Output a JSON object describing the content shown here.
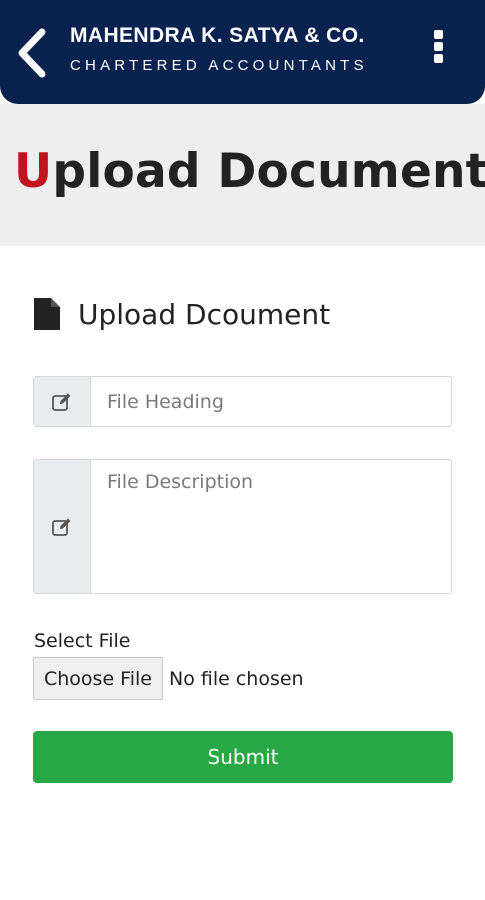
{
  "header": {
    "back_icon": "chevron-left-icon",
    "brand_name": "MAHENDRA K. SATYA & CO.",
    "brand_tagline": "CHARTERED ACCOUNTANTS",
    "menu_icon": "vertical-dots-icon",
    "background_color": "#0a2250"
  },
  "banner": {
    "title_first_letter": "U",
    "title_rest": "pload Document",
    "accent_color": "#c0121f"
  },
  "form": {
    "section_icon": "file-icon",
    "section_title": "Upload Dcoument",
    "heading_field": {
      "icon": "edit-icon",
      "placeholder": "File Heading",
      "value": ""
    },
    "description_field": {
      "icon": "edit-icon",
      "placeholder": "File Description",
      "value": ""
    },
    "select_file_label": "Select File",
    "choose_file_label": "Choose File",
    "file_status": "No file chosen",
    "submit_label": "Submit",
    "submit_color": "#28a745"
  }
}
